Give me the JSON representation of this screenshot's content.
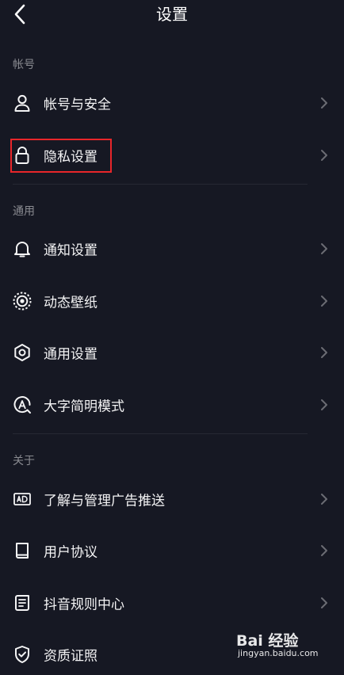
{
  "header": {
    "title": "设置",
    "back_icon": "back-arrow-icon"
  },
  "sections": [
    {
      "label": "帐号",
      "items": [
        {
          "label": "帐号与安全",
          "icon": "user-icon"
        },
        {
          "label": "隐私设置",
          "icon": "lock-icon",
          "highlighted": true
        }
      ]
    },
    {
      "label": "通用",
      "items": [
        {
          "label": "通知设置",
          "icon": "bell-icon"
        },
        {
          "label": "动态壁纸",
          "icon": "live-wallpaper-icon"
        },
        {
          "label": "通用设置",
          "icon": "gear-icon"
        },
        {
          "label": "大字简明模式",
          "icon": "large-font-icon"
        }
      ]
    },
    {
      "label": "关于",
      "items": [
        {
          "label": "了解与管理广告推送",
          "icon": "ad-icon"
        },
        {
          "label": "用户协议",
          "icon": "book-icon"
        },
        {
          "label": "抖音规则中心",
          "icon": "document-icon"
        },
        {
          "label": "资质证照",
          "icon": "shield-check-icon"
        }
      ]
    }
  ],
  "watermark": {
    "logo": "Bai 经验",
    "brand": "经验",
    "url": "jingyan.baidu.com"
  },
  "colors": {
    "background": "#161823",
    "text": "#f4f4f5",
    "section_label": "#8a8b91",
    "chevron": "#6b6c73",
    "divider": "#262833",
    "highlight": "#e8262a"
  }
}
